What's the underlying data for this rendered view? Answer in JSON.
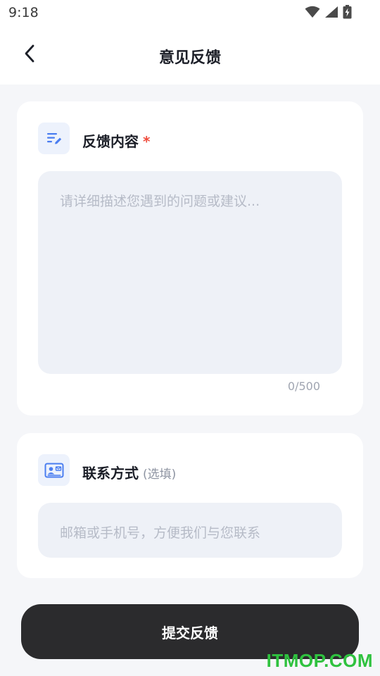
{
  "status_bar": {
    "time": "9:18",
    "icons": [
      "wifi-icon",
      "signal-icon",
      "battery-charging-icon"
    ]
  },
  "header": {
    "title": "意见反馈",
    "back_icon": "chevron-left-icon"
  },
  "feedback_section": {
    "icon": "edit-list-icon",
    "title": "反馈内容",
    "required_mark": "*",
    "placeholder": "请详细描述您遇到的问题或建议...",
    "value": "",
    "char_count": "0/500"
  },
  "contact_section": {
    "icon": "contact-card-icon",
    "title": "联系方式",
    "optional_note": "(选填)",
    "placeholder": "邮箱或手机号，方便我们与您联系",
    "value": ""
  },
  "submit": {
    "label": "提交反馈"
  },
  "watermark": {
    "text": "ITMOP.COM"
  },
  "colors": {
    "accent_icon": "#4a7df0",
    "required": "#ef4b3c",
    "button_bg": "#2b2b2d",
    "watermark": "#2fc23f"
  }
}
